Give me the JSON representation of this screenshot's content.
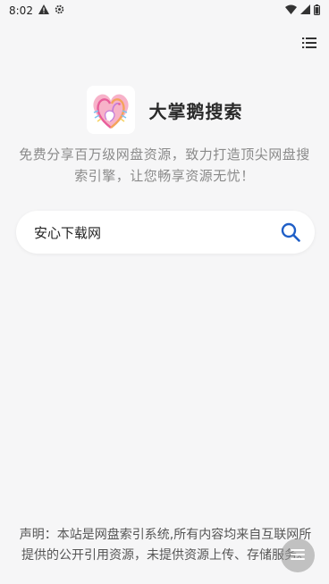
{
  "status_bar": {
    "time": "8:02",
    "icons": [
      "alert-icon",
      "settings-gear-icon",
      "wifi-icon",
      "signal-icon",
      "battery-icon"
    ]
  },
  "header": {
    "menu_icon": "list-menu-icon"
  },
  "brand": {
    "name": "大掌鹅搜索",
    "logo_icon": "swan-heart-logo"
  },
  "tagline": "免费分享百万级网盘资源，致力打造顶尖网盘搜索引擎，让您畅享资源无忧！",
  "search": {
    "value": "安心下载网",
    "icon": "search-icon",
    "accent": "#1f5fc7"
  },
  "disclaimer": "声明：本站是网盘索引系统,所有内容均来自互联网所提供的公开引用资源，未提供资源上传、存储服务。",
  "fab": {
    "icon": "menu-lines-icon"
  }
}
